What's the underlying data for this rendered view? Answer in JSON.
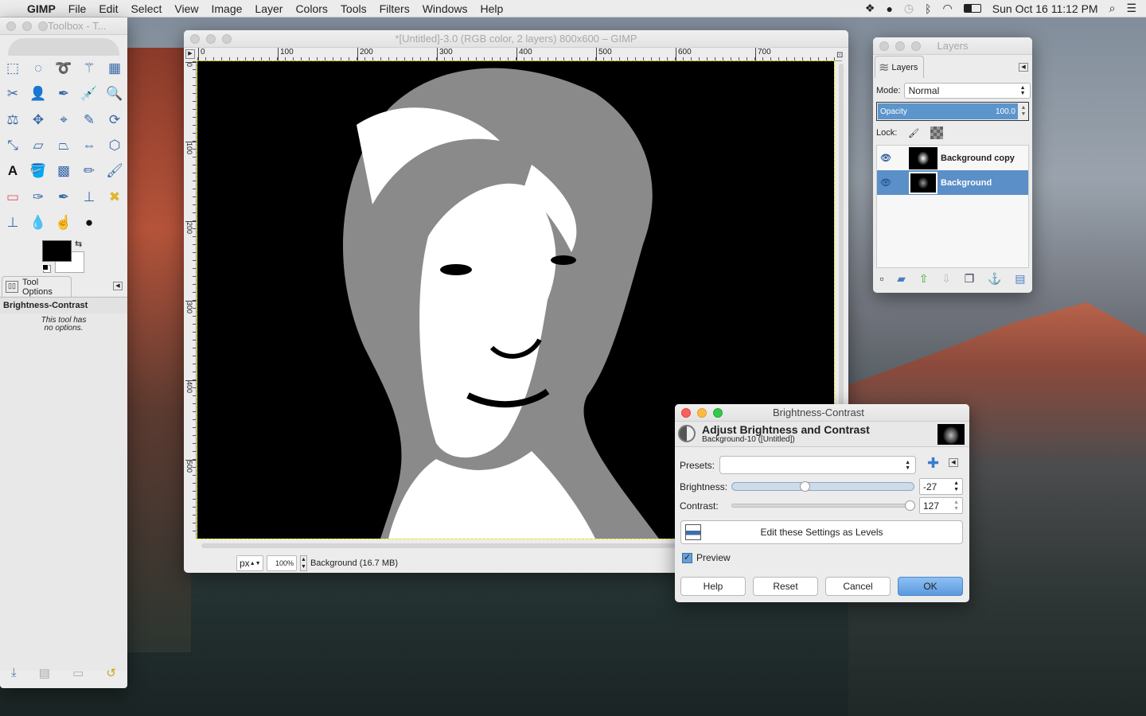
{
  "menubar": {
    "app": "GIMP",
    "items": [
      "File",
      "Edit",
      "Select",
      "View",
      "Image",
      "Layer",
      "Colors",
      "Tools",
      "Filters",
      "Windows",
      "Help"
    ],
    "clock": "Sun Oct 16  11:12 PM"
  },
  "toolbox": {
    "title": "Toolbox - T...",
    "tools": [
      "rect-select-icon",
      "ellipse-select-icon",
      "free-select-icon",
      "fuzzy-select-icon",
      "select-by-color-icon",
      "scissors-icon",
      "foreground-select-icon",
      "paths-icon",
      "color-picker-icon",
      "zoom-icon",
      "measure-icon",
      "move-icon",
      "align-icon",
      "crop-icon",
      "rotate-icon",
      "scale-icon",
      "shear-icon",
      "perspective-icon",
      "flip-icon",
      "cage-transform-icon",
      "text-icon",
      "bucket-fill-icon",
      "blend-icon",
      "pencil-icon",
      "paintbrush-icon",
      "eraser-icon",
      "airbrush-icon",
      "ink-icon",
      "clone-icon",
      "heal-icon",
      "perspective-clone-icon",
      "blur-icon",
      "smudge-icon",
      "dodge-burn-icon"
    ],
    "fg_color": "#000000",
    "bg_color": "#ffffff",
    "options_tab": "Tool Options",
    "tool_name": "Brightness-Contrast",
    "no_options": "This tool has no options."
  },
  "image_window": {
    "title": "*[Untitled]-3.0 (RGB color, 2 layers) 800x600 – GIMP",
    "ruler_top": [
      "0",
      "100",
      "200",
      "300",
      "400",
      "500",
      "600",
      "700"
    ],
    "ruler_left": [
      "0",
      "100",
      "200",
      "300",
      "400",
      "500"
    ],
    "unit": "px",
    "zoom": "100%",
    "status": "Background (16.7 MB)"
  },
  "layers": {
    "title": "Layers",
    "tab": "Layers",
    "mode_label": "Mode:",
    "mode": "Normal",
    "opacity_label": "Opacity",
    "opacity": "100.0",
    "lock_label": "Lock:",
    "items": [
      {
        "name": "Background copy",
        "selected": false
      },
      {
        "name": "Background",
        "selected": true
      }
    ]
  },
  "dialog": {
    "title": "Brightness-Contrast",
    "heading": "Adjust Brightness and Contrast",
    "subheading": "Background-10 ([Untitled])",
    "presets_label": "Presets:",
    "presets_value": "",
    "brightness_label": "Brightness:",
    "brightness": "-27",
    "brightness_range": [
      -127,
      127
    ],
    "contrast_label": "Contrast:",
    "contrast": "127",
    "contrast_range": [
      -127,
      127
    ],
    "levels_button": "Edit these Settings as Levels",
    "preview_label": "Preview",
    "preview_checked": true,
    "buttons": {
      "help": "Help",
      "reset": "Reset",
      "cancel": "Cancel",
      "ok": "OK"
    }
  },
  "colors": {
    "accent": "#5a93cc",
    "selection": "#5b8fc7"
  }
}
